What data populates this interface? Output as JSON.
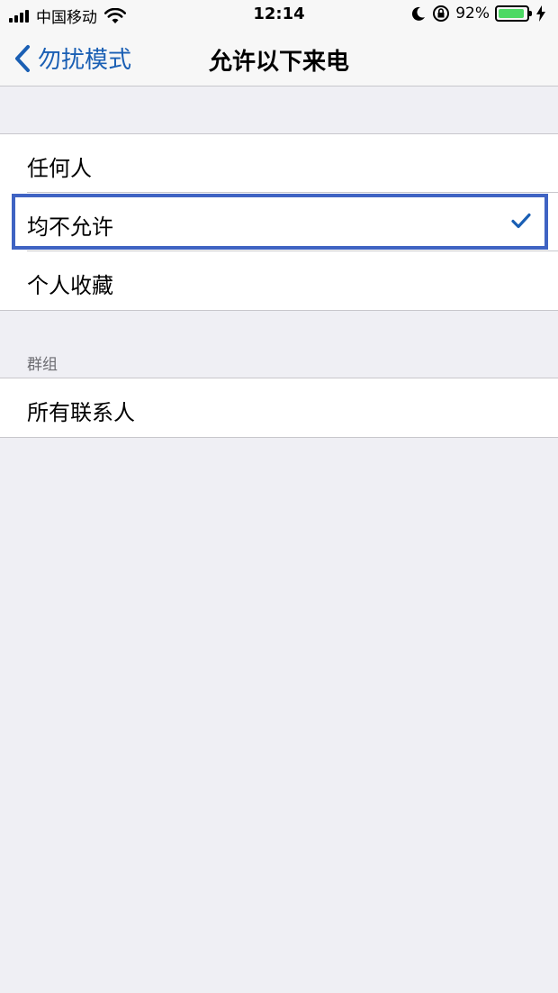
{
  "status_bar": {
    "carrier": "中国移动",
    "time": "12:14",
    "battery_percent": "92%",
    "battery_level": 0.92
  },
  "nav": {
    "back_label": "勿扰模式",
    "title": "允许以下来电"
  },
  "options": [
    {
      "label": "任何人",
      "selected": false
    },
    {
      "label": "均不允许",
      "selected": true
    },
    {
      "label": "个人收藏",
      "selected": false
    }
  ],
  "groups_section": {
    "header": "群组",
    "items": [
      {
        "label": "所有联系人"
      }
    ]
  },
  "colors": {
    "accent": "#1a5fb4",
    "highlight_border": "#3f63c3",
    "background": "#efeff4"
  },
  "icons": [
    "wifi-icon",
    "moon-icon",
    "rotation-lock-icon",
    "battery-icon",
    "charging-bolt-icon",
    "chevron-left-icon",
    "checkmark-icon"
  ]
}
